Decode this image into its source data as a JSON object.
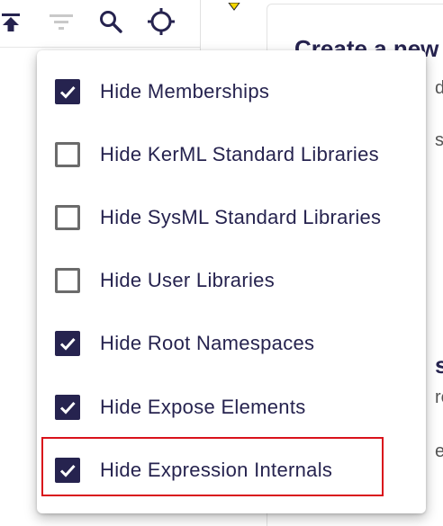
{
  "toolbar": {
    "icons": [
      "collapse-up-icon",
      "filter-icon",
      "search-icon",
      "crosshair-icon"
    ]
  },
  "background": {
    "title": "Create a new",
    "fragments": [
      "d",
      "s",
      "s",
      "re",
      "e"
    ]
  },
  "menu": {
    "items": [
      {
        "label": "Hide Memberships",
        "checked": true
      },
      {
        "label": "Hide KerML Standard Libraries",
        "checked": false
      },
      {
        "label": "Hide SysML Standard Libraries",
        "checked": false
      },
      {
        "label": "Hide User Libraries",
        "checked": false
      },
      {
        "label": "Hide Root Namespaces",
        "checked": true
      },
      {
        "label": "Hide Expose Elements",
        "checked": true
      },
      {
        "label": "Hide Expression Internals",
        "checked": true
      }
    ]
  },
  "colors": {
    "accent": "#26234f",
    "highlight": "#d9121b"
  }
}
